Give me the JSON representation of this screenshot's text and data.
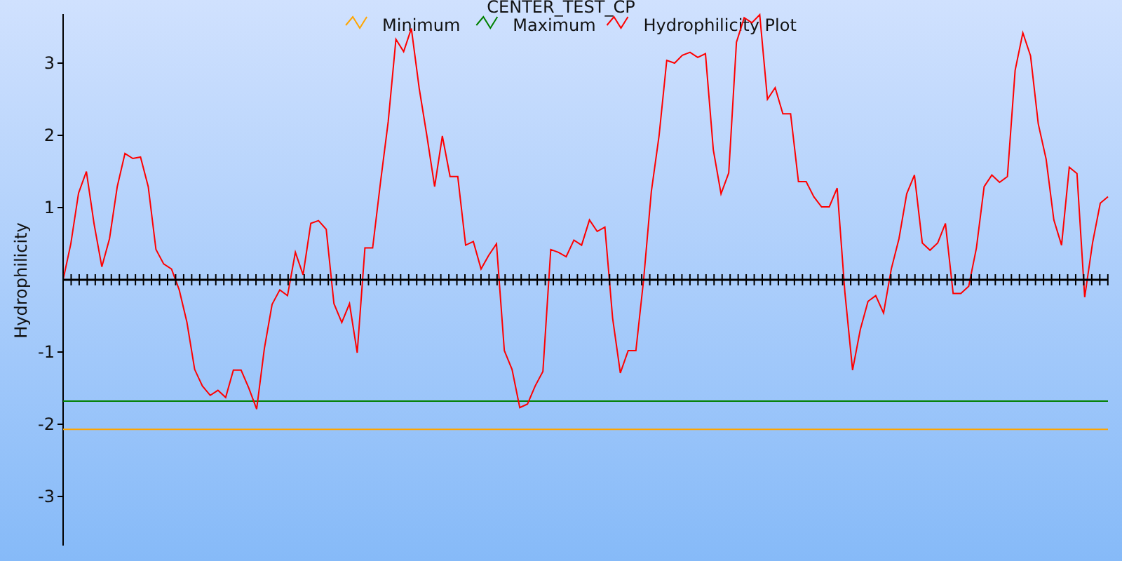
{
  "chart_data": {
    "type": "line",
    "title": "CENTER_TEST_CP",
    "ylabel": "Hydrophilicity",
    "legend": "top",
    "ylim": [
      -3.68,
      3.68
    ],
    "yticks": [
      -3,
      -2,
      -1,
      1,
      2,
      3
    ],
    "categories": [
      null,
      null,
      null,
      null,
      null,
      null,
      null,
      null,
      null,
      null,
      null,
      null,
      null,
      null,
      null,
      null,
      null,
      null,
      null,
      null,
      null,
      null,
      null,
      null,
      null,
      null,
      null,
      null,
      null,
      null,
      null,
      null,
      null,
      null,
      null,
      null,
      null,
      null,
      null,
      null,
      null,
      null,
      null,
      null,
      null,
      null,
      null,
      null,
      null,
      null,
      null,
      null,
      null,
      null,
      null,
      null,
      null,
      null,
      null,
      null,
      null,
      null,
      null,
      null,
      null,
      null,
      null,
      null,
      null,
      null,
      null,
      null,
      null,
      null,
      null,
      null,
      null,
      null,
      null,
      null,
      null,
      null,
      null,
      null,
      null,
      null,
      null,
      null,
      null,
      null,
      null,
      null,
      null,
      null,
      null,
      null,
      null,
      null,
      null,
      null,
      null,
      null,
      null,
      null,
      null,
      null,
      null,
      null,
      null,
      null,
      null,
      null,
      null,
      null,
      null,
      null,
      null,
      null,
      null,
      null,
      null,
      null,
      null,
      null,
      null,
      null,
      null,
      null,
      null,
      null,
      null,
      null,
      null,
      null,
      null,
      null
    ],
    "series": [
      {
        "name": "Minimum",
        "color": "#ffa500",
        "values": [
          -2.07,
          -2.07,
          -2.07,
          -2.07,
          -2.07,
          -2.07,
          -2.07,
          -2.07,
          -2.07,
          -2.07,
          -2.07,
          -2.07,
          -2.07,
          -2.07,
          -2.07,
          -2.07,
          -2.07,
          -2.07,
          -2.07,
          -2.07,
          -2.07,
          -2.07,
          -2.07,
          -2.07,
          -2.07,
          -2.07,
          -2.07,
          -2.07,
          -2.07,
          -2.07,
          -2.07,
          -2.07,
          -2.07,
          -2.07,
          -2.07,
          -2.07,
          -2.07,
          -2.07,
          -2.07,
          -2.07,
          -2.07,
          -2.07,
          -2.07,
          -2.07,
          -2.07,
          -2.07,
          -2.07,
          -2.07,
          -2.07,
          -2.07,
          -2.07,
          -2.07,
          -2.07,
          -2.07,
          -2.07,
          -2.07,
          -2.07,
          -2.07,
          -2.07,
          -2.07,
          -2.07,
          -2.07,
          -2.07,
          -2.07,
          -2.07,
          -2.07,
          -2.07,
          -2.07,
          -2.07,
          -2.07,
          -2.07,
          -2.07,
          -2.07,
          -2.07,
          -2.07,
          -2.07,
          -2.07,
          -2.07,
          -2.07,
          -2.07,
          -2.07,
          -2.07,
          -2.07,
          -2.07,
          -2.07,
          -2.07,
          -2.07,
          -2.07,
          -2.07,
          -2.07,
          -2.07,
          -2.07,
          -2.07,
          -2.07,
          -2.07,
          -2.07,
          -2.07,
          -2.07,
          -2.07,
          -2.07,
          -2.07,
          -2.07,
          -2.07,
          -2.07,
          -2.07,
          -2.07,
          -2.07,
          -2.07,
          -2.07,
          -2.07,
          -2.07,
          -2.07,
          -2.07,
          -2.07,
          -2.07,
          -2.07,
          -2.07,
          -2.07,
          -2.07,
          -2.07,
          -2.07,
          -2.07,
          -2.07,
          -2.07,
          -2.07,
          -2.07,
          -2.07,
          -2.07,
          -2.07,
          -2.07,
          -2.07,
          -2.07,
          -2.07,
          -2.07,
          -2.07,
          -2.07
        ]
      },
      {
        "name": "Maximum",
        "color": "#008000",
        "values": [
          -1.68,
          -1.68,
          -1.68,
          -1.68,
          -1.68,
          -1.68,
          -1.68,
          -1.68,
          -1.68,
          -1.68,
          -1.68,
          -1.68,
          -1.68,
          -1.68,
          -1.68,
          -1.68,
          -1.68,
          -1.68,
          -1.68,
          -1.68,
          -1.68,
          -1.68,
          -1.68,
          -1.68,
          -1.68,
          -1.68,
          -1.68,
          -1.68,
          -1.68,
          -1.68,
          -1.68,
          -1.68,
          -1.68,
          -1.68,
          -1.68,
          -1.68,
          -1.68,
          -1.68,
          -1.68,
          -1.68,
          -1.68,
          -1.68,
          -1.68,
          -1.68,
          -1.68,
          -1.68,
          -1.68,
          -1.68,
          -1.68,
          -1.68,
          -1.68,
          -1.68,
          -1.68,
          -1.68,
          -1.68,
          -1.68,
          -1.68,
          -1.68,
          -1.68,
          -1.68,
          -1.68,
          -1.68,
          -1.68,
          -1.68,
          -1.68,
          -1.68,
          -1.68,
          -1.68,
          -1.68,
          -1.68,
          -1.68,
          -1.68,
          -1.68,
          -1.68,
          -1.68,
          -1.68,
          -1.68,
          -1.68,
          -1.68,
          -1.68,
          -1.68,
          -1.68,
          -1.68,
          -1.68,
          -1.68,
          -1.68,
          -1.68,
          -1.68,
          -1.68,
          -1.68,
          -1.68,
          -1.68,
          -1.68,
          -1.68,
          -1.68,
          -1.68,
          -1.68,
          -1.68,
          -1.68,
          -1.68,
          -1.68,
          -1.68,
          -1.68,
          -1.68,
          -1.68,
          -1.68,
          -1.68,
          -1.68,
          -1.68,
          -1.68,
          -1.68,
          -1.68,
          -1.68,
          -1.68,
          -1.68,
          -1.68,
          -1.68,
          -1.68,
          -1.68,
          -1.68,
          -1.68,
          -1.68,
          -1.68,
          -1.68,
          -1.68,
          -1.68,
          -1.68,
          -1.68,
          -1.68,
          -1.68,
          -1.68,
          -1.68,
          -1.68,
          -1.68,
          -1.68,
          -1.68
        ]
      },
      {
        "name": "Hydrophilicity Plot",
        "color": "#ff0000",
        "values": [
          0,
          0.5,
          1.2,
          1.5,
          0.77,
          0.18,
          0.57,
          1.29,
          1.75,
          1.68,
          1.7,
          1.29,
          0.42,
          0.22,
          0.15,
          -0.14,
          -0.59,
          -1.24,
          -1.47,
          -1.6,
          -1.53,
          -1.63,
          -1.25,
          -1.25,
          -1.5,
          -1.79,
          -0.95,
          -0.34,
          -0.14,
          -0.22,
          0.38,
          0.07,
          0.78,
          0.82,
          0.7,
          -0.33,
          -0.59,
          -0.33,
          -1.01,
          0.44,
          0.44,
          1.35,
          2.19,
          3.33,
          3.16,
          3.48,
          2.65,
          1.99,
          1.29,
          1.99,
          1.43,
          1.43,
          0.48,
          0.53,
          0.15,
          0.34,
          0.5,
          -0.98,
          -1.24,
          -1.77,
          -1.72,
          -1.47,
          -1.27,
          0.42,
          0.38,
          0.32,
          0.55,
          0.48,
          0.83,
          0.67,
          0.73,
          -0.53,
          -1.29,
          -0.98,
          -0.98,
          0,
          1.22,
          1.99,
          3.04,
          3.0,
          3.11,
          3.15,
          3.08,
          3.13,
          1.8,
          1.19,
          1.48,
          3.29,
          3.63,
          3.56,
          3.67,
          2.5,
          2.66,
          2.3,
          2.3,
          1.36,
          1.36,
          1.15,
          1.01,
          1.01,
          1.27,
          -0.17,
          -1.25,
          -0.69,
          -0.3,
          -0.22,
          -0.46,
          0.15,
          0.57,
          1.19,
          1.45,
          0.51,
          0.41,
          0.51,
          0.78,
          -0.19,
          -0.19,
          -0.09,
          0.44,
          1.29,
          1.45,
          1.35,
          1.43,
          2.9,
          3.42,
          3.1,
          2.16,
          1.67,
          0.83,
          0.48,
          1.56,
          1.47,
          -0.24,
          0.51,
          1.06,
          1.15
        ]
      }
    ]
  }
}
